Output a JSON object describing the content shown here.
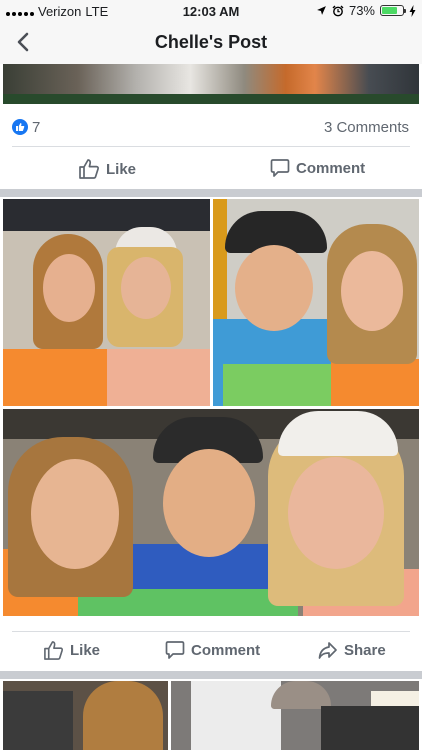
{
  "status": {
    "carrier": "Verizon",
    "network": "LTE",
    "time": "12:03 AM",
    "battery": "73%",
    "battery_level": 0.73
  },
  "nav": {
    "title": "Chelle's Post"
  },
  "post1": {
    "like_count": "7",
    "comments": "3 Comments",
    "like_label": "Like",
    "comment_label": "Comment"
  },
  "post2": {
    "like_label": "Like",
    "comment_label": "Comment",
    "share_label": "Share"
  },
  "colors": {
    "accent": "#1877f2",
    "separator": "#c9ccd1",
    "action_text": "#606770"
  },
  "icons": [
    "chevron-left-icon",
    "location-arrow-icon",
    "alarm-clock-icon",
    "battery-icon",
    "charging-bolt-icon",
    "like-thumb-icon",
    "comment-bubble-icon",
    "share-arrow-icon"
  ]
}
